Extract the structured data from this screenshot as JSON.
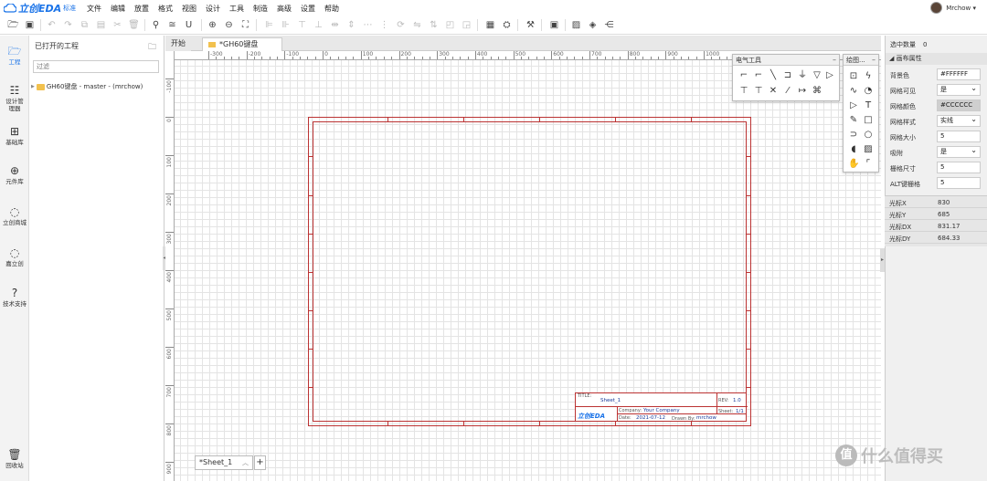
{
  "app": {
    "logo_text": "立创EDA",
    "logo_badge": "标准"
  },
  "menus": [
    "文件",
    "编辑",
    "放置",
    "格式",
    "视图",
    "设计",
    "工具",
    "制造",
    "高级",
    "设置",
    "帮助"
  ],
  "user": {
    "name": "Mrchow ▾"
  },
  "rail": [
    {
      "label": "工程",
      "icon": "folder-icon",
      "glyph": "🗁"
    },
    {
      "label": "设计管理器",
      "icon": "design-manager-icon",
      "glyph": "☷"
    },
    {
      "label": "基础库",
      "icon": "basic-library-icon",
      "glyph": "⊞"
    },
    {
      "label": "元件库",
      "icon": "component-search-icon",
      "glyph": "⊕"
    },
    {
      "label": "立创商城",
      "icon": "lcsc-mall-icon",
      "glyph": "◌"
    },
    {
      "label": "嘉立创",
      "icon": "jlc-icon",
      "glyph": "◌"
    },
    {
      "label": "技术支持",
      "icon": "support-icon",
      "glyph": "?"
    },
    {
      "label": "回收站",
      "icon": "recycle-bin-icon",
      "glyph": "🗑"
    }
  ],
  "project_panel": {
    "title": "已打开的工程",
    "filter_placeholder": "过滤",
    "project_item": "GH60键盘 - master - (mrchow)"
  },
  "tabs": [
    {
      "label": "开始"
    },
    {
      "label": "*GH60键盘"
    }
  ],
  "ruler": {
    "h_labels": [
      "-300",
      "-200",
      "-100",
      "0",
      "100",
      "200",
      "300",
      "400",
      "500",
      "600",
      "700",
      "800",
      "900",
      "1000"
    ],
    "v_labels": [
      "-100",
      "0",
      "100",
      "200",
      "300",
      "400",
      "500",
      "600",
      "700",
      "800",
      "900"
    ]
  },
  "title_block": {
    "title_label": "TITLE:",
    "title_value": "Sheet_1",
    "rev_label": "REV:",
    "rev_value": "1.0",
    "company_label": "Company:",
    "company_value": "Your Company",
    "sheet_label": "Sheet:",
    "sheet_value": "1/1",
    "date_label": "Date:",
    "date_value": "2021-07-12",
    "drawn_label": "Drawn By:",
    "drawn_value": "mrchow",
    "logo_text": "立创EDA"
  },
  "electrical_tools": {
    "title": "电气工具"
  },
  "drawing_tools": {
    "title": "绘图..."
  },
  "sheet_tab": {
    "label": "*Sheet_1"
  },
  "properties": {
    "selected_label": "选中数量",
    "selected_count": "0",
    "section_title": "画布属性",
    "rows": [
      {
        "label": "背景色",
        "value": "#FFFFFF",
        "type": "input"
      },
      {
        "label": "网格可见",
        "value": "是",
        "type": "select"
      },
      {
        "label": "网格颜色",
        "value": "#CCCCCC",
        "type": "gray"
      },
      {
        "label": "网格样式",
        "value": "实线",
        "type": "select"
      },
      {
        "label": "网格大小",
        "value": "5",
        "type": "input"
      },
      {
        "label": "吸附",
        "value": "是",
        "type": "select"
      },
      {
        "label": "栅格尺寸",
        "value": "5",
        "type": "input"
      },
      {
        "label": "ALT键栅格",
        "value": "5",
        "type": "input"
      }
    ],
    "cursor": [
      {
        "label": "光标X",
        "value": "830"
      },
      {
        "label": "光标Y",
        "value": "685"
      },
      {
        "label": "光标DX",
        "value": "831.17"
      },
      {
        "label": "光标DY",
        "value": "684.33"
      }
    ]
  },
  "watermark": {
    "badge": "值",
    "text": "什么值得买"
  },
  "colors": {
    "accent": "#1a73e8",
    "sheet_border": "#b33333",
    "grid": "#e4e4e4"
  }
}
